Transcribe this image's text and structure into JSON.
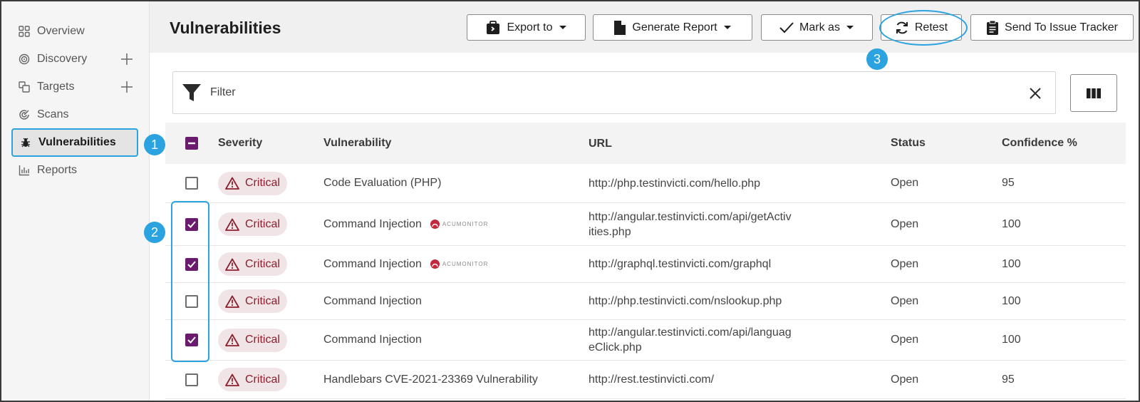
{
  "sidebar": {
    "items": [
      {
        "label": "Overview",
        "icon": "grid-icon"
      },
      {
        "label": "Discovery",
        "icon": "target-icon",
        "plus": true
      },
      {
        "label": "Targets",
        "icon": "targets-icon",
        "plus": true
      },
      {
        "label": "Scans",
        "icon": "scan-icon"
      },
      {
        "label": "Vulnerabilities",
        "icon": "bug-icon",
        "active": true
      },
      {
        "label": "Reports",
        "icon": "chart-icon"
      }
    ]
  },
  "header": {
    "title": "Vulnerabilities",
    "buttons": {
      "export": "Export to",
      "generate": "Generate Report",
      "mark": "Mark as",
      "retest": "Retest",
      "send": "Send To Issue Tracker"
    }
  },
  "callouts": [
    "1",
    "2",
    "3"
  ],
  "filter": {
    "label": "Filter"
  },
  "table": {
    "headers": {
      "severity": "Severity",
      "vulnerability": "Vulnerability",
      "url": "URL",
      "status": "Status",
      "confidence": "Confidence %"
    },
    "rows": [
      {
        "checked": false,
        "severity": "Critical",
        "vulnerability": "Code Evaluation (PHP)",
        "acumonitor": false,
        "url_line1": "http://php.testinvicti.com/hello.php",
        "url_line2": "",
        "status": "Open",
        "confidence": "95"
      },
      {
        "checked": true,
        "severity": "Critical",
        "vulnerability": "Command Injection",
        "acumonitor": true,
        "url_line1": "http://angular.testinvicti.com/api/getActiv",
        "url_line2": "ities.php",
        "status": "Open",
        "confidence": "100"
      },
      {
        "checked": true,
        "severity": "Critical",
        "vulnerability": "Command Injection",
        "acumonitor": true,
        "url_line1": "http://graphql.testinvicti.com/graphql",
        "url_line2": "",
        "status": "Open",
        "confidence": "100"
      },
      {
        "checked": false,
        "severity": "Critical",
        "vulnerability": "Command Injection",
        "acumonitor": false,
        "url_line1": "http://php.testinvicti.com/nslookup.php",
        "url_line2": "",
        "status": "Open",
        "confidence": "100"
      },
      {
        "checked": true,
        "severity": "Critical",
        "vulnerability": "Command Injection",
        "acumonitor": false,
        "url_line1": "http://angular.testinvicti.com/api/languag",
        "url_line2": "eClick.php",
        "status": "Open",
        "confidence": "100"
      },
      {
        "checked": false,
        "severity": "Critical",
        "vulnerability": "Handlebars CVE-2021-23369 Vulnerability",
        "acumonitor": false,
        "url_line1": "http://rest.testinvicti.com/",
        "url_line2": "",
        "status": "Open",
        "confidence": "95"
      }
    ]
  },
  "acumonitor_label": "ACUMONITOR",
  "colors": {
    "accent": "#2ba3e0",
    "checkbox": "#6a1b6e",
    "critical": "#8b1f2d",
    "critical_bg": "#f1e4e6"
  }
}
